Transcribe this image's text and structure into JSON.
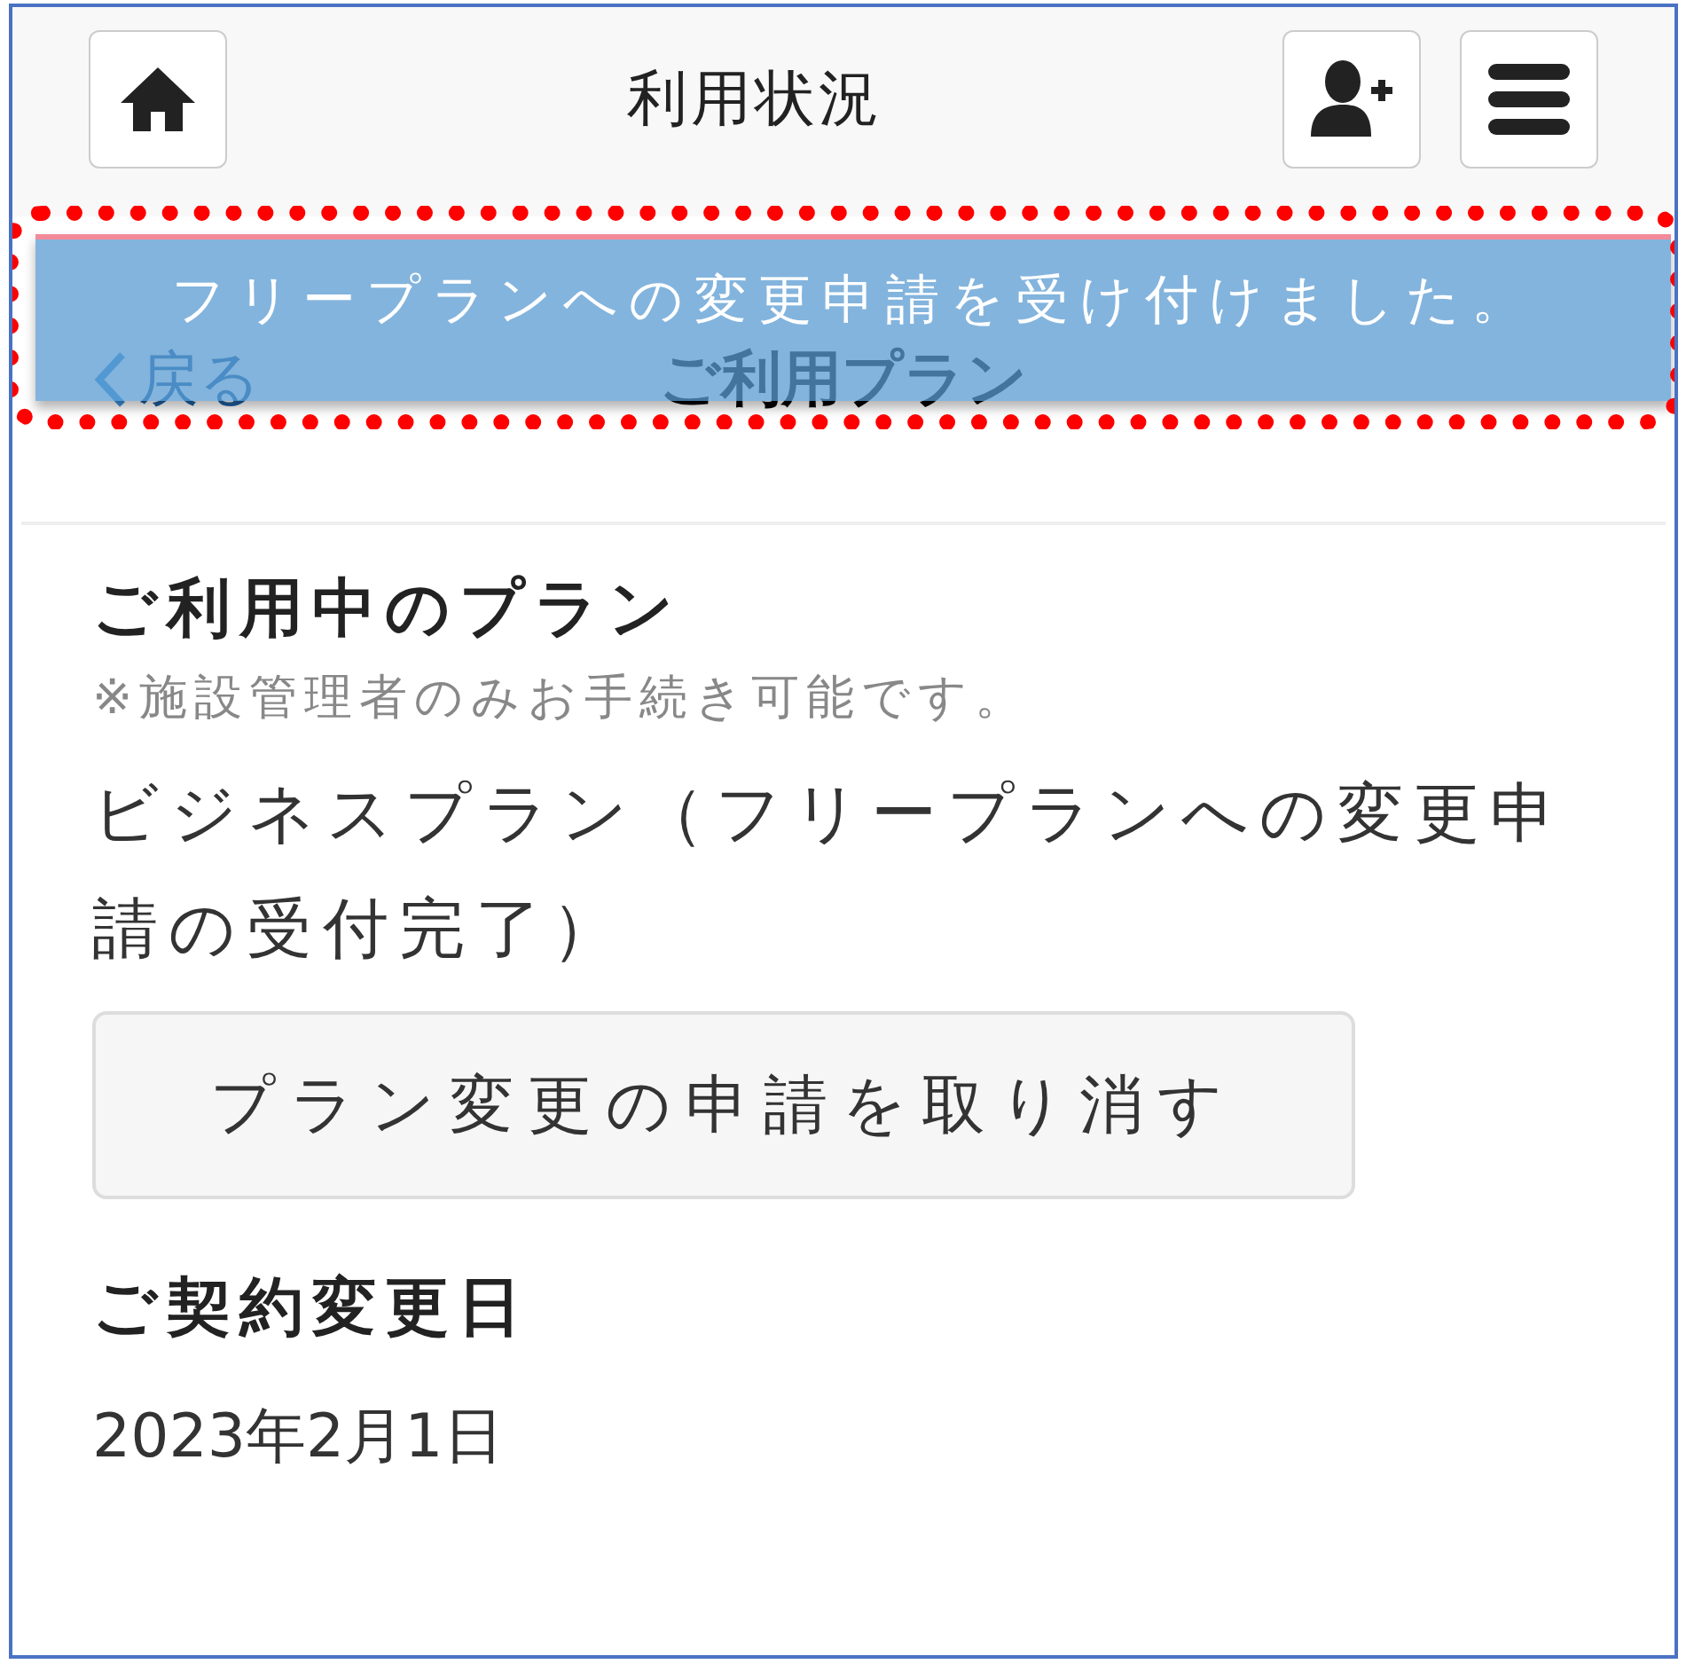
{
  "header": {
    "title": "利用状況",
    "buttons": [
      {
        "kind": "home"
      },
      {
        "kind": "add-user"
      },
      {
        "kind": "menu"
      }
    ]
  },
  "subheader": {
    "back": "戻る",
    "title": "ご利用プラン"
  },
  "toast": {
    "message": "フリープランへの変更申請を受け付けました。"
  },
  "sections": [
    {
      "kind": "plan",
      "heading": "ご利用中のプラン",
      "note": "※施設管理者のみお手続き可能です。",
      "value": "ビジネスプラン（フリープランへの変更申請の受付完了）",
      "button": "プラン変更の申請を取り消す"
    },
    {
      "kind": "date",
      "heading": "ご契約変更日",
      "value": "2023年2月1日"
    }
  ]
}
